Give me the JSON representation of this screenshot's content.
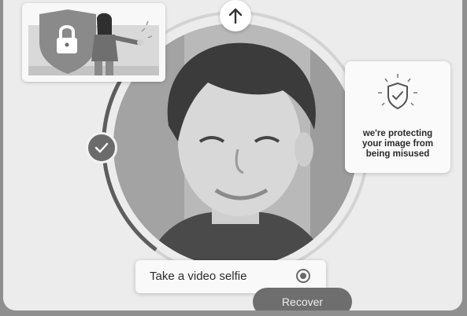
{
  "protect_card": {
    "message": "we're protecting\nyour image from\nbeing misused",
    "icon": "shield-check-icon"
  },
  "selfie_bar": {
    "label": "Take a video selfie",
    "icon": "record-icon"
  },
  "recover_button": {
    "label": "Recover"
  },
  "up_button": {
    "icon": "arrow-up-icon"
  },
  "check_button": {
    "icon": "check-icon"
  },
  "illustration": {
    "icon": "lock-shield-icon"
  },
  "colors": {
    "background": "#ececec",
    "frame": "#8f8f8f",
    "accent_dark": "#6e6e6e",
    "card": "#fafafa"
  }
}
